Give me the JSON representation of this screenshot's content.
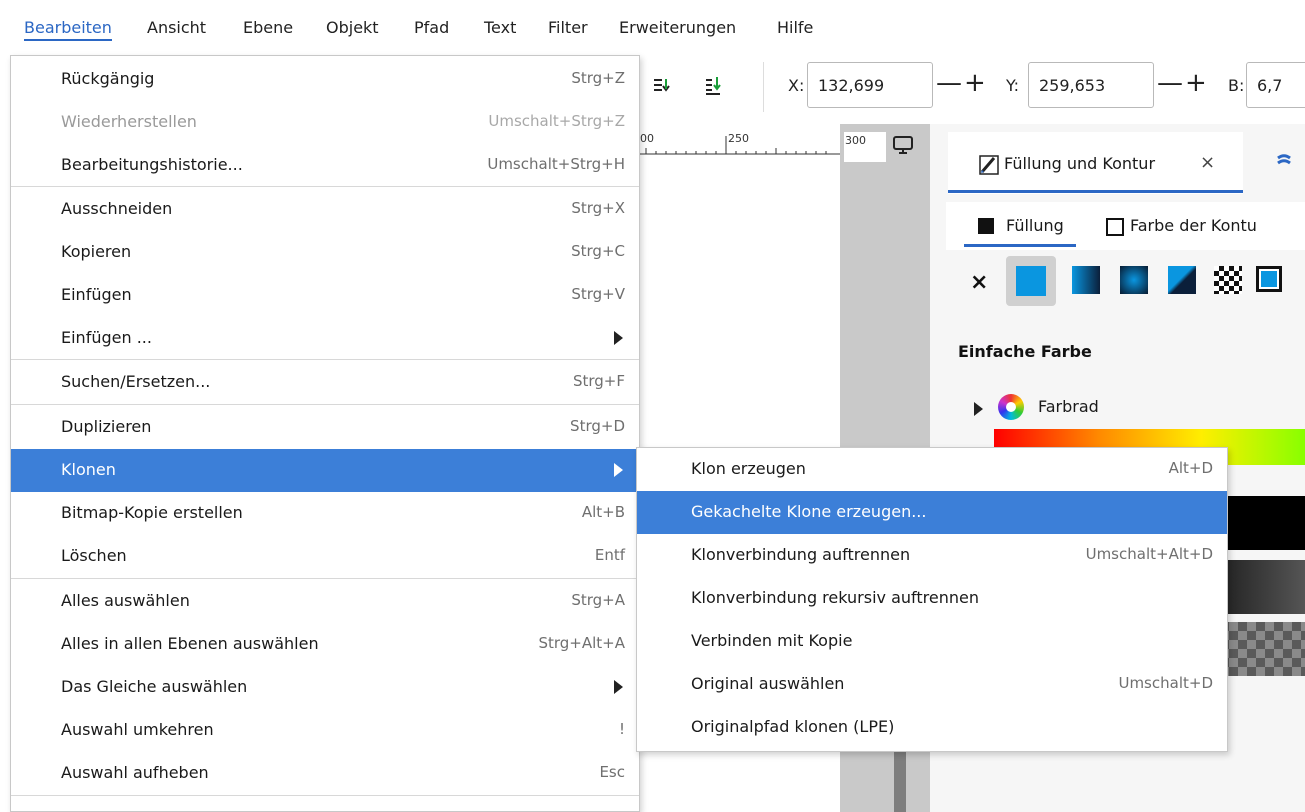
{
  "menubar": {
    "items": [
      "Bearbeiten",
      "Ansicht",
      "Ebene",
      "Objekt",
      "Pfad",
      "Text",
      "Filter",
      "Erweiterungen",
      "Hilfe"
    ]
  },
  "toolbar": {
    "x_label": "X:",
    "x_value": "132,699",
    "y_label": "Y:",
    "y_value": "259,653",
    "b_label": "B:",
    "b_value": "6,7",
    "minus": "—",
    "plus": "+"
  },
  "ruler": {
    "ticks": [
      "00",
      "250",
      "300"
    ]
  },
  "panel": {
    "tab_title": "Füllung und Kontur",
    "tab_close": "×",
    "fill_tab": "Füllung",
    "stroke_tab": "Farbe der Kontu",
    "flat_color_title": "Einfache Farbe",
    "color_wheel_label": "Farbrad",
    "none_symbol": "×",
    "colors": {
      "accent": "#0a96e0",
      "highlight": "#3c7fd8"
    }
  },
  "edit_menu": {
    "items": [
      {
        "label": "Rückgängig",
        "shortcut": "Strg+Z"
      },
      {
        "label": "Wiederherstellen",
        "shortcut": "Umschalt+Strg+Z"
      },
      {
        "label": "Bearbeitungshistorie...",
        "shortcut": "Umschalt+Strg+H"
      },
      {
        "label": "Ausschneiden",
        "shortcut": "Strg+X"
      },
      {
        "label": "Kopieren",
        "shortcut": "Strg+C"
      },
      {
        "label": "Einfügen",
        "shortcut": "Strg+V"
      },
      {
        "label": "Einfügen ...",
        "shortcut": ""
      },
      {
        "label": "Suchen/Ersetzen...",
        "shortcut": "Strg+F"
      },
      {
        "label": "Duplizieren",
        "shortcut": "Strg+D"
      },
      {
        "label": "Klonen",
        "shortcut": ""
      },
      {
        "label": "Bitmap-Kopie erstellen",
        "shortcut": "Alt+B"
      },
      {
        "label": "Löschen",
        "shortcut": "Entf"
      },
      {
        "label": "Alles auswählen",
        "shortcut": "Strg+A"
      },
      {
        "label": "Alles in allen Ebenen auswählen",
        "shortcut": "Strg+Alt+A"
      },
      {
        "label": "Das Gleiche auswählen",
        "shortcut": ""
      },
      {
        "label": "Auswahl umkehren",
        "shortcut": "!"
      },
      {
        "label": "Auswahl aufheben",
        "shortcut": "Esc"
      }
    ]
  },
  "clone_submenu": {
    "items": [
      {
        "label": "Klon erzeugen",
        "shortcut": "Alt+D"
      },
      {
        "label": "Gekachelte Klone erzeugen...",
        "shortcut": ""
      },
      {
        "label": "Klonverbindung auftrennen",
        "shortcut": "Umschalt+Alt+D"
      },
      {
        "label": "Klonverbindung rekursiv auftrennen",
        "shortcut": ""
      },
      {
        "label": "Verbinden mit Kopie",
        "shortcut": ""
      },
      {
        "label": "Original auswählen",
        "shortcut": "Umschalt+D"
      },
      {
        "label": "Originalpfad klonen (LPE)",
        "shortcut": ""
      }
    ]
  }
}
